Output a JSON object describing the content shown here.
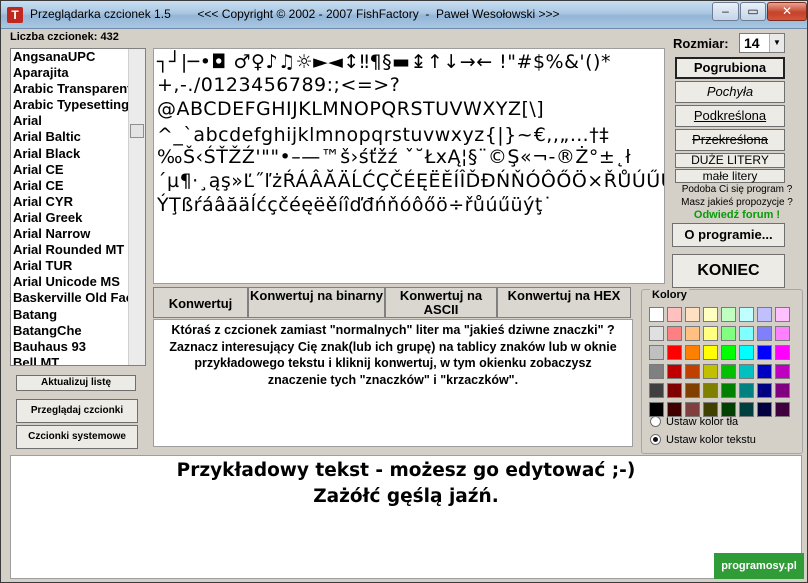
{
  "window": {
    "title": "Przeglądarka czcionek 1.5        <<< Copyright © 2002 - 2007 FishFactory  -  Paweł Wesołowski >>>",
    "icon_letter": "T",
    "buttons": {
      "minimize": "–",
      "maximize": "▭",
      "close": "✕"
    }
  },
  "font_count_label": "Liczba czcionek: 432",
  "font_list": [
    "AngsanaUPC",
    "Aparajita",
    "Arabic Transparent",
    "Arabic Typesetting",
    "Arial",
    "Arial Baltic",
    "Arial Black",
    "Arial CE",
    "Arial CE",
    "Arial CYR",
    "Arial Greek",
    "Arial Narrow",
    "Arial Rounded MT Bold",
    "Arial TUR",
    "Arial Unicode MS",
    "Baskerville Old Face",
    "Batang",
    "BatangChe",
    "Bauhaus 93",
    "Bell MT"
  ],
  "left_buttons": {
    "refresh": "Aktualizuj listę",
    "browse": "Przeglądaj czcionki",
    "system": "Czcionki systemowe"
  },
  "preview_lines": [
    "┐┘|─•◘  ♂♀♪♫☼►◄↕‼¶§▬↨↑↓→← !\"#$%&'()*",
    "+,-./0123456789:;<=>?",
    "@ABCDEFGHIJKLMNOPQRSTUVWXYZ[\\]",
    "^_`abcdefghijklmnopqrstuvwxyz{|}~€,,„…†‡",
    "‰Š‹ŚŤŽŹ'\"\"•–—™š›śťžź ˇ˘ŁxĄ¦§¨©Ş«¬-®Ż°±˛ł",
    "´µ¶·¸ąş»Ľ˝ľżŔÁÂĂÄĹĆÇČÉĘËĚÍÎĎĐŃŇÓÔŐÖ×ŘŮÚŰÜ",
    "ÝŢßŕáâăäĺćçčéęëěíîďđńňóôőö÷řůúűüýţ˙"
  ],
  "convert_buttons": [
    {
      "label": "Konwertuj"
    },
    {
      "label": "Konwertuj na binarny"
    },
    {
      "label": "Konwertuj na ASCII"
    },
    {
      "label": "Konwertuj na HEX"
    }
  ],
  "info_text": "Któraś z czcionek zamiast \"normalnych\" liter ma \"jakieś dziwne znaczki\" ? Zaznacz interesujący Cię znak(lub ich grupę) na tablicy znaków lub w oknie przykładowego tekstu i kliknij konwertuj, w tym okienku zobaczysz znaczenie tych \"znaczków\" i \"krzaczków\".",
  "size": {
    "label": "Rozmiar:",
    "value": "14"
  },
  "style_buttons": {
    "bold": "Pogrubiona",
    "italic": "Pochyła",
    "underline": "Podkreślona",
    "strike": "Przekreślona",
    "upper": "DUŻE LITERY",
    "lower": "małe litery"
  },
  "promo": {
    "line1": "Podoba Ci się program ?",
    "line2": "Masz jakieś propozycje ?",
    "link": "Odwiedź forum !"
  },
  "about_button": "O programie...",
  "exit_button": "KONIEC",
  "colors": {
    "title": "Kolory",
    "palette": [
      "#ffffff",
      "#ffc0c0",
      "#ffe0c0",
      "#ffffc0",
      "#c0ffc0",
      "#c0ffff",
      "#c0c0ff",
      "#ffc0ff",
      "#e0e0e0",
      "#ff8080",
      "#ffc080",
      "#ffff80",
      "#80ff80",
      "#80ffff",
      "#8080ff",
      "#ff80ff",
      "#c0c0c0",
      "#ff0000",
      "#ff8000",
      "#ffff00",
      "#00ff00",
      "#00ffff",
      "#0000ff",
      "#ff00ff",
      "#808080",
      "#c00000",
      "#c04000",
      "#c0c000",
      "#00c000",
      "#00c0c0",
      "#0000c0",
      "#c000c0",
      "#404040",
      "#800000",
      "#804000",
      "#808000",
      "#008000",
      "#008080",
      "#000080",
      "#800080",
      "#000000",
      "#400000",
      "#804040",
      "#404000",
      "#004000",
      "#004040",
      "#000040",
      "#400040"
    ],
    "radio_bg": "Ustaw kolor tła",
    "radio_text": "Ustaw kolor tekstu"
  },
  "sample_text": {
    "line1": "Przykładowy tekst - możesz go edytować ;-)",
    "line2": "Zażółć gęślą jaźń."
  },
  "watermark": "programosy.pl"
}
